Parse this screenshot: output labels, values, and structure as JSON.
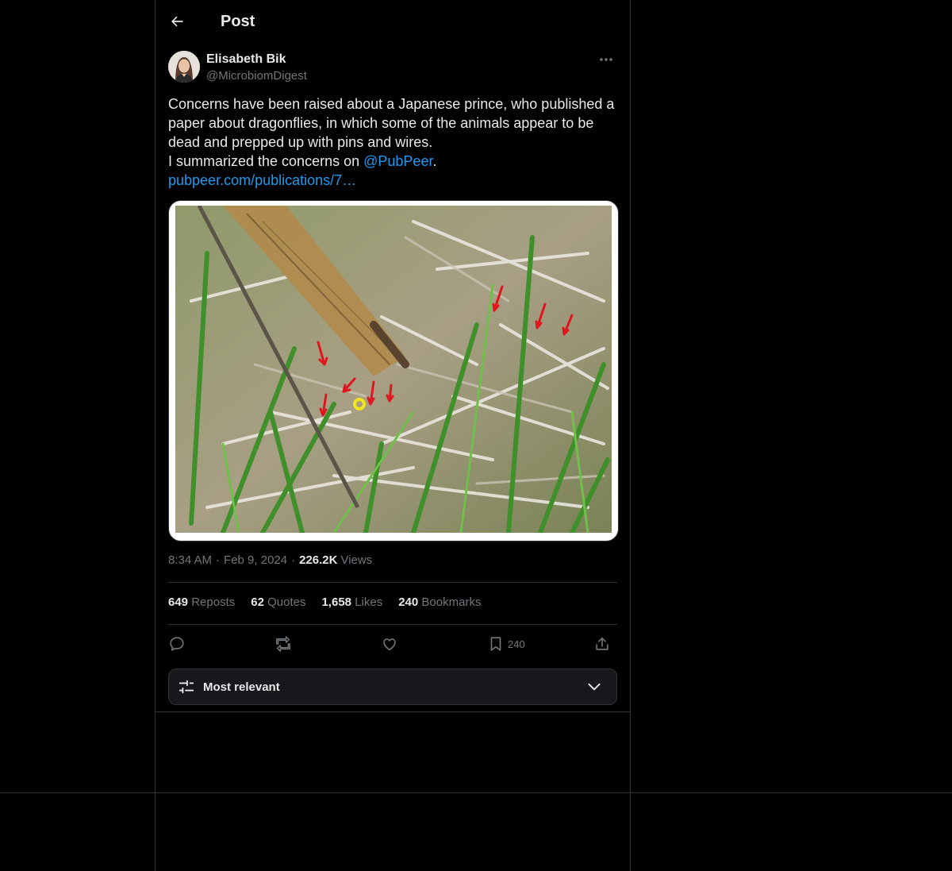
{
  "header": {
    "title": "Post"
  },
  "author": {
    "name": "Elisabeth Bik",
    "handle": "@MicrobiomDigest"
  },
  "tweet": {
    "line1": "Concerns have been raised about a Japanese prince, who published a",
    "line2": "paper about dragonflies, in which some of the animals appear to be",
    "line3": "dead and prepped up with pins and wires.",
    "line4_prefix": "I summarized the concerns on ",
    "mention": "@PubPeer",
    "line4_suffix": ".",
    "link": "pubpeer.com/publications/7…"
  },
  "meta": {
    "time": "8:34 AM",
    "sep": "·",
    "date": "Feb 9, 2024",
    "views_count": "226.2K",
    "views_label": "Views"
  },
  "stats": {
    "reposts_count": "649",
    "reposts_label": "Reposts",
    "quotes_count": "62",
    "quotes_label": "Quotes",
    "likes_count": "1,658",
    "likes_label": "Likes",
    "bookmarks_count": "240",
    "bookmarks_label": "Bookmarks"
  },
  "actions": {
    "bookmark_count": "240"
  },
  "sort": {
    "label": "Most relevant"
  },
  "colors": {
    "background": "#000000",
    "text": "#e7e9ea",
    "muted": "#71767b",
    "link": "#1d9bf0",
    "border": "#2f3336"
  },
  "icons": [
    "back-arrow-icon",
    "more-icon",
    "reply-icon",
    "repost-icon",
    "like-icon",
    "bookmark-icon",
    "share-icon",
    "sliders-icon",
    "chevron-down-icon"
  ]
}
